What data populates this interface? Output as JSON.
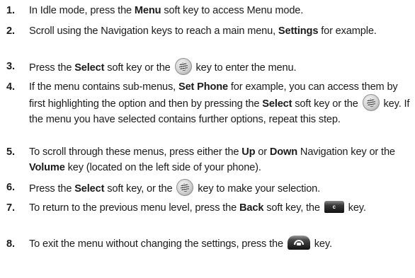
{
  "steps": [
    {
      "number": "1.",
      "parts": [
        "In Idle mode, press the ",
        "Menu",
        " soft key to access Menu mode."
      ]
    },
    {
      "number": "2.",
      "parts": [
        "Scroll using the Navigation keys to reach a main menu, ",
        "Settings",
        " for example."
      ]
    },
    {
      "number": "3.",
      "parts": [
        "Press the ",
        "Select",
        " soft key or the ",
        "key to enter the menu."
      ]
    },
    {
      "number": "4.",
      "parts": [
        "If the menu contains sub-menus, ",
        "Set Phone",
        " for example, you can access them by first highlighting the option and then by pressing the ",
        "Select",
        " soft key or the ",
        "key. If the menu you have selected contains further options, repeat this step."
      ]
    },
    {
      "number": "5.",
      "parts": [
        "To scroll through these menus, press either the ",
        "Up",
        " or ",
        "Down",
        " Navigation key or the ",
        "Volume",
        " key (located on the left side of your phone)."
      ]
    },
    {
      "number": "6.",
      "parts": [
        "Press the ",
        "Select",
        " soft key, or the ",
        "key to make your selection."
      ]
    },
    {
      "number": "7.",
      "parts": [
        "To return to the previous menu level, press the ",
        "Back",
        " soft key, the ",
        "key."
      ]
    },
    {
      "number": "8.",
      "parts": [
        "To exit the menu without changing the settings, press the ",
        "key."
      ]
    }
  ],
  "icons": {
    "select_key": "navigation-select-key-icon",
    "clear_key": "clear-key-icon",
    "clear_key_label": "c",
    "end_key": "end-power-key-icon"
  }
}
